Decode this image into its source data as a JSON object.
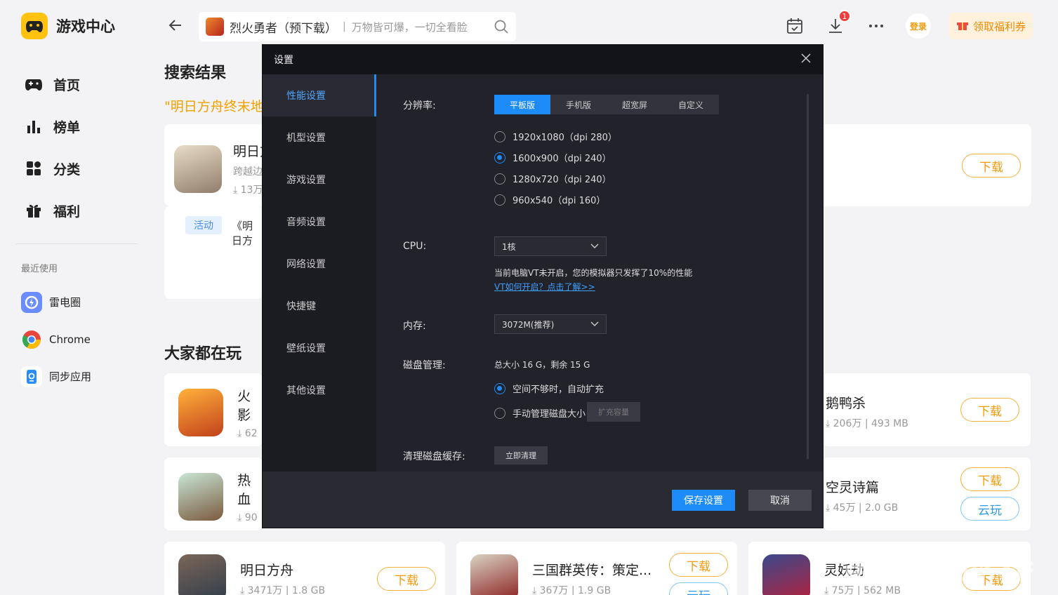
{
  "app": {
    "title": "游戏中心",
    "nav": [
      {
        "label": "首页",
        "icon": "gamepad-icon"
      },
      {
        "label": "榜单",
        "icon": "chart-bars-icon"
      },
      {
        "label": "分类",
        "icon": "grid-icon"
      },
      {
        "label": "福利",
        "icon": "gift-icon"
      }
    ],
    "recent_title": "最近使用",
    "recent": [
      {
        "label": "雷电圈",
        "icon": "leidian-circle-icon",
        "color": "#6a8cff"
      },
      {
        "label": "Chrome",
        "icon": "chrome-icon",
        "color": "#e8453c"
      },
      {
        "label": "同步应用",
        "icon": "sync-app-icon",
        "color": "#2a8cf5"
      }
    ]
  },
  "search": {
    "game": "烈火勇者（预下载）",
    "separator": "|",
    "hint": "万物皆可爆，一切全看脸"
  },
  "toolbar": {
    "download_badge": "1",
    "login_label": "登录",
    "welfare_label": "领取福利券"
  },
  "results": {
    "title": "搜索结果",
    "query": "\"明日方舟终末地\"",
    "game_name": "明日方",
    "game_desc": "跨越边",
    "game_downloads": "13万",
    "activity_tag": "活动",
    "activity_text": "《明日方",
    "download_label": "下载"
  },
  "popular": {
    "title": "大家都在玩",
    "games": [
      {
        "name": "火影",
        "downloads": "62",
        "size": ""
      },
      {
        "name": "热血",
        "downloads": "90",
        "size": ""
      },
      {
        "name": "明日方舟",
        "downloads": "3471万",
        "size": "1.8 GB"
      },
      {
        "name": "三国群英传：策定...",
        "downloads": "367万",
        "size": "1.9 GB"
      },
      {
        "name": "鹅鸭杀",
        "downloads": "206万",
        "size": "493 MB"
      },
      {
        "name": "空灵诗篇",
        "downloads": "45万",
        "size": "2.0 GB"
      },
      {
        "name": "灵妖劫",
        "downloads": "75万",
        "size": "562 MB"
      }
    ],
    "download_label": "下载",
    "cloud_label": "云玩"
  },
  "watermark": "雷电模拟器",
  "settings": {
    "title": "设置",
    "sidebar": [
      "性能设置",
      "机型设置",
      "游戏设置",
      "音频设置",
      "网络设置",
      "快捷键",
      "壁纸设置",
      "其他设置"
    ],
    "active_index": 0,
    "resolution_label": "分辨率:",
    "resolution_tabs": [
      "平板版",
      "手机版",
      "超宽屏",
      "自定义"
    ],
    "resolution_selected": 0,
    "resolutions": [
      "1920x1080（dpi 280）",
      "1600x900（dpi 240）",
      "1280x720（dpi 240）",
      "960x540（dpi 160）"
    ],
    "resolution_checked": 1,
    "cpu_label": "CPU:",
    "cpu_value": "1核",
    "vt_note": "当前电脑VT未开启，您的模拟器只发挥了10%的性能",
    "vt_link": "VT如何开启？点击了解>>",
    "memory_label": "内存:",
    "memory_value": "3072M(推荐)",
    "disk_label": "磁盘管理:",
    "disk_info": "总大小 16 G，剩余 15 G",
    "disk_auto": "空间不够时，自动扩充",
    "disk_manual": "手动管理磁盘大小",
    "disk_expand": "扩充容量",
    "cache_label": "清理磁盘缓存:",
    "cache_button": "立即清理",
    "save_label": "保存设置",
    "cancel_label": "取消",
    "accent_color": "#1d8cf8"
  }
}
